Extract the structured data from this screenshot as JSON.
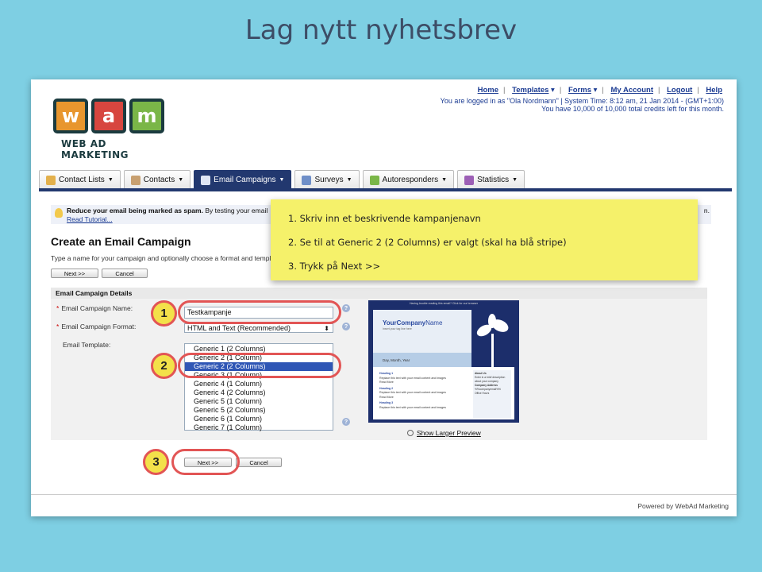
{
  "slide": {
    "title": "Lag nytt nyhetsbrev"
  },
  "header": {
    "links": [
      "Home",
      "Templates",
      "Forms",
      "My Account",
      "Logout",
      "Help"
    ],
    "login_line": "You are logged in as \"Ola Nordmann\" | System Time: 8:12 am, 21 Jan 2014 - (GMT+1:00)",
    "credits_line": "You have 10,000 of 10,000 total credits left for this month."
  },
  "logo": {
    "letters": [
      "w",
      "a",
      "m"
    ],
    "tile_colors": [
      "#e8962e",
      "#d7463f",
      "#7ab648"
    ],
    "text": "WEB AD MARKETING"
  },
  "nav": {
    "tabs": [
      "Contact Lists",
      "Contacts",
      "Email Campaigns",
      "Surveys",
      "Autoresponders",
      "Statistics"
    ],
    "active": "Email Campaigns"
  },
  "tip": {
    "bold": "Reduce your email being marked as spam.",
    "text": " By testing your email",
    "link": "Read Tutorial...",
    "tail": "n."
  },
  "page": {
    "title": "Create an Email Campaign",
    "subtitle": "Type a name for your campaign and optionally choose a format and templa",
    "next_label": "Next >>",
    "cancel_label": "Cancel"
  },
  "form": {
    "section": "Email Campaign Details",
    "name_label": "Email Campaign Name:",
    "name_value": "Testkampanje",
    "format_label": "Email Campaign Format:",
    "format_value": "HTML and Text (Recommended)",
    "template_label": "Email Template:",
    "templates": [
      "Generic 1 (2 Columns)",
      "Generic 2 (1 Column)",
      "Generic 2 (2 Columns)",
      "Generic 3 (1 Column)",
      "Generic 4 (1 Column)",
      "Generic 4 (2 Columns)",
      "Generic 5 (1 Column)",
      "Generic 5 (2 Columns)",
      "Generic 6 (1 Column)",
      "Generic 7 (1 Column)"
    ],
    "selected_template": "Generic 2 (2 Columns)",
    "required_mark": "*",
    "help_glyph": "?"
  },
  "preview": {
    "top_text": "Having trouble reading this email? Click for our browser",
    "company_a": "YourCompany",
    "company_b": "Name",
    "tagline": "Insert your tag line here",
    "date": "Day, Month, Year",
    "headings": [
      "Heading 1",
      "Heading 2",
      "Heading 3"
    ],
    "body": "Replace this text with your email content and images",
    "read_more": "Read More",
    "about_title": "About Us",
    "about_text": "Enter in a brief description about your company",
    "address_title": "Company Address",
    "email": "%%companyemail%%",
    "hours": "Office Hours",
    "link_label": "Show Larger Preview"
  },
  "footer": {
    "powered": "Powered by WebAd Marketing"
  },
  "note": {
    "items": [
      "1. Skriv inn et beskrivende kampanjenavn",
      "2. Se til at Generic 2 (2 Columns) er valgt (skal ha blå stripe)",
      "3. Trykk på Next >>"
    ]
  },
  "badges": [
    "1",
    "2",
    "3"
  ],
  "colors": {
    "nav_active": "#22386f",
    "highlight_ring": "#e25555",
    "note_bg": "#f5f16a",
    "selected_option": "#2f56b5"
  }
}
